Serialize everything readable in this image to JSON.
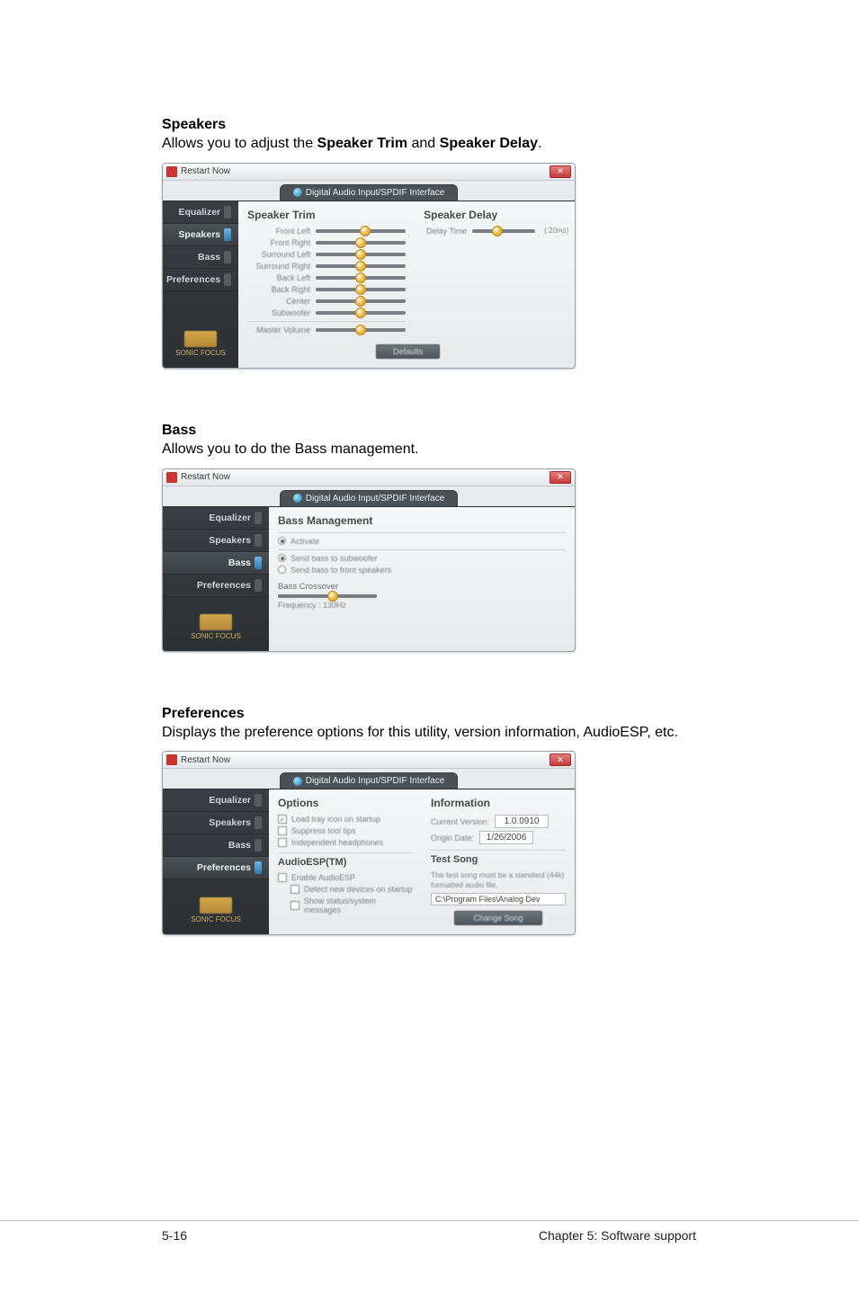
{
  "sections": {
    "speakers": {
      "title": "Speakers",
      "desc_pre": "Allows you to adjust the ",
      "desc_b1": "Speaker Trim",
      "desc_mid": " and ",
      "desc_b2": "Speaker Delay",
      "desc_post": "."
    },
    "bass": {
      "title": "Bass",
      "desc": "Allows you to do the Bass management."
    },
    "prefs": {
      "title": "Preferences",
      "desc": "Displays the preference options for this utility, version information, AudioESP, etc."
    }
  },
  "window_title": "Restart Now",
  "tab_label": "Digital Audio Input/SPDIF Interface",
  "sidebar": {
    "items": [
      "Equalizer",
      "Speakers",
      "Bass",
      "Preferences"
    ]
  },
  "brand": "SONIC FOCUS",
  "speakers_panel": {
    "title_left": "Speaker Trim",
    "title_right": "Speaker Delay",
    "sliders_left": [
      "Front Left",
      "Front Right",
      "Surround Left",
      "Surround Right",
      "Back Left",
      "Back Right",
      "Center",
      "Subwoofer"
    ],
    "master": "Master Volume",
    "delay_label": "Delay Time",
    "delay_unit": "(:20ms)",
    "defaults": "Defaults"
  },
  "bass_panel": {
    "title": "Bass Management",
    "activate": "Activate",
    "opt1": "Send bass to subwoofer",
    "opt2": "Send bass to front speakers",
    "crossover": "Bass Crossover",
    "freq": "Frequency : 130Hz"
  },
  "prefs_panel": {
    "options_title": "Options",
    "opt1": "Load tray icon on startup",
    "opt2": "Suppress tool tips",
    "opt3": "Independent headphones",
    "esp_title": "AudioESP(TM)",
    "esp_enable": "Enable AudioESP",
    "esp_sub1": "Detect new devices on startup",
    "esp_sub2": "Show status/system messages",
    "info_title": "Information",
    "ver_label": "Current Version:",
    "ver_value": "1.0.0910",
    "date_label": "Origin Date:",
    "date_value": "1/26/2006",
    "test_title": "Test Song",
    "test_desc": "The test song must be a standard (44k) formatted audio file.",
    "test_path": "C:\\Program Files\\Analog Dev",
    "change": "Change Song"
  },
  "footer": {
    "left": "5-16",
    "right": "Chapter 5: Software support"
  }
}
